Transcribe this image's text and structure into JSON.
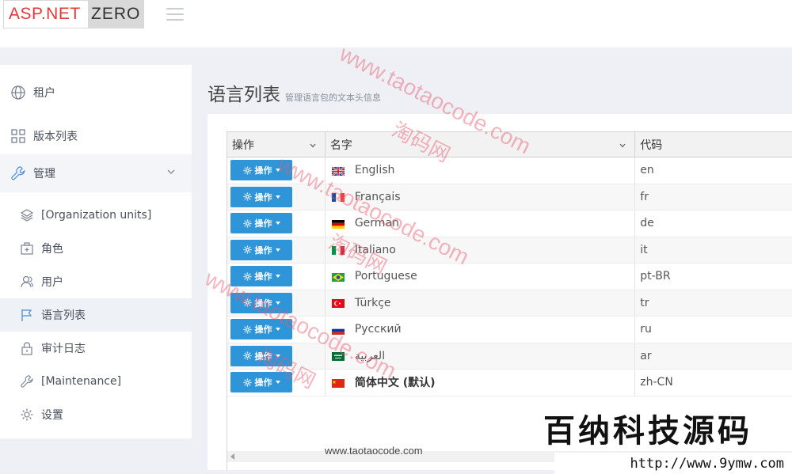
{
  "header": {
    "logo_left": "ASP.NET",
    "logo_right": "ZERO"
  },
  "sidebar": {
    "items": [
      {
        "label": "租户",
        "icon": "globe-icon"
      },
      {
        "label": "版本列表",
        "icon": "grid-icon"
      },
      {
        "label": "管理",
        "icon": "wrench-icon",
        "expanded": true
      }
    ],
    "sub_items": [
      {
        "label": "[Organization units]",
        "icon": "layers-icon"
      },
      {
        "label": "角色",
        "icon": "briefcase-icon"
      },
      {
        "label": "用户",
        "icon": "users-icon"
      },
      {
        "label": "语言列表",
        "icon": "flag-icon",
        "selected": true
      },
      {
        "label": "审计日志",
        "icon": "lock-icon"
      },
      {
        "label": "[Maintenance]",
        "icon": "wrench-icon"
      },
      {
        "label": "设置",
        "icon": "gear-icon"
      }
    ]
  },
  "page": {
    "title": "语言列表",
    "subtitle": "管理语言包的文本头信息"
  },
  "table": {
    "columns": [
      "操作",
      "名字",
      "代码"
    ],
    "action_label": "操作",
    "rows": [
      {
        "name": "English",
        "code": "en",
        "flag": "gb"
      },
      {
        "name": "Français",
        "code": "fr",
        "flag": "fr"
      },
      {
        "name": "German",
        "code": "de",
        "flag": "de"
      },
      {
        "name": "Italiano",
        "code": "it",
        "flag": "it"
      },
      {
        "name": "Portuguese",
        "code": "pt-BR",
        "flag": "br"
      },
      {
        "name": "Türkçe",
        "code": "tr",
        "flag": "tr"
      },
      {
        "name": "Русский",
        "code": "ru",
        "flag": "ru"
      },
      {
        "name": "العربية",
        "code": "ar",
        "flag": "sa"
      },
      {
        "name": "简体中文 (默认)",
        "code": "zh-CN",
        "flag": "cn",
        "bold": true
      }
    ]
  },
  "watermarks": {
    "url": "www.taotaocode.com",
    "cn": "淘码网",
    "bottom": "www.taotaocode.com",
    "brand_cn": "百纳科技源码",
    "brand_url": "http://www.9ymw.com"
  },
  "colors": {
    "accent": "#2e95d8",
    "logo_red": "#e03a3a"
  }
}
